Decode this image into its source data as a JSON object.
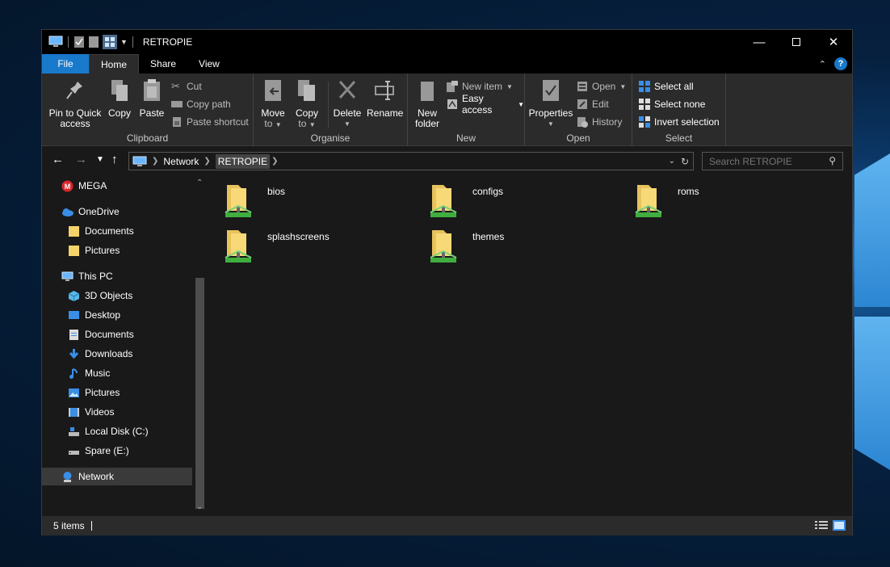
{
  "window": {
    "title": "RETROPIE",
    "accent": "#1979ca"
  },
  "ribbon_tabs": [
    "File",
    "Home",
    "Share",
    "View"
  ],
  "ribbon": {
    "clipboard": {
      "label": "Clipboard",
      "pin_line1": "Pin to Quick",
      "pin_line2": "access",
      "copy": "Copy",
      "paste": "Paste",
      "cut": "Cut",
      "copy_path": "Copy path",
      "paste_shortcut": "Paste shortcut"
    },
    "organise": {
      "label": "Organise",
      "move_line1": "Move",
      "move_line2": "to",
      "copyto_line1": "Copy",
      "copyto_line2": "to",
      "delete": "Delete",
      "rename": "Rename"
    },
    "new": {
      "label": "New",
      "folder_line1": "New",
      "folder_line2": "folder",
      "new_item": "New item",
      "easy_access": "Easy access"
    },
    "open": {
      "label": "Open",
      "properties": "Properties",
      "open": "Open",
      "edit": "Edit",
      "history": "History"
    },
    "select": {
      "label": "Select",
      "select_all": "Select all",
      "select_none": "Select none",
      "invert": "Invert selection"
    }
  },
  "address": {
    "crumbs": [
      "Network",
      "RETROPIE"
    ],
    "search_placeholder": "Search RETROPIE"
  },
  "nav_pane": {
    "items": [
      {
        "label": "MEGA",
        "icon": "mega-icon"
      },
      {
        "label": "OneDrive",
        "icon": "onedrive-icon"
      },
      {
        "label": "Documents",
        "icon": "folder-icon"
      },
      {
        "label": "Pictures",
        "icon": "folder-icon"
      },
      {
        "label": "This PC",
        "icon": "computer-icon"
      },
      {
        "label": "3D Objects",
        "icon": "cube-icon"
      },
      {
        "label": "Desktop",
        "icon": "desktop-icon"
      },
      {
        "label": "Documents",
        "icon": "document-icon"
      },
      {
        "label": "Downloads",
        "icon": "download-icon"
      },
      {
        "label": "Music",
        "icon": "music-icon"
      },
      {
        "label": "Pictures",
        "icon": "pictures-icon"
      },
      {
        "label": "Videos",
        "icon": "video-icon"
      },
      {
        "label": "Local Disk (C:)",
        "icon": "drive-icon"
      },
      {
        "label": "Spare (E:)",
        "icon": "drive-icon"
      },
      {
        "label": "Network",
        "icon": "network-icon",
        "selected": true
      }
    ]
  },
  "files": [
    "bios",
    "configs",
    "roms",
    "splashscreens",
    "themes"
  ],
  "status": {
    "item_count": "5 items"
  }
}
